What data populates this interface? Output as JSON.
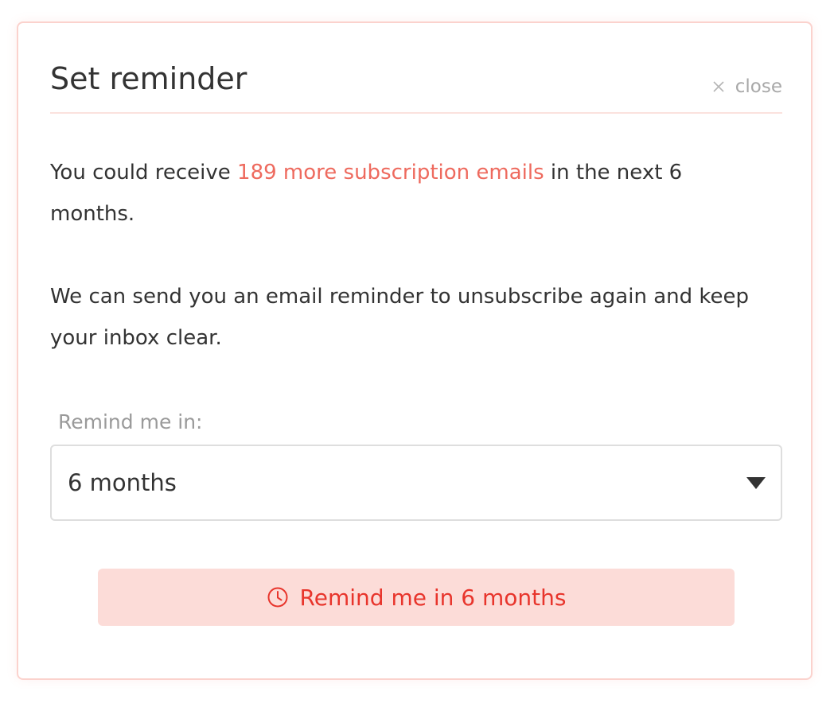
{
  "dialog": {
    "title": "Set reminder",
    "close_label": "close"
  },
  "intro": {
    "before": "You could receive ",
    "highlight": "189 more subscription emails",
    "after": " in the next 6 months."
  },
  "reminder_text": "We can send you an email reminder to unsubscribe again and keep your inbox clear.",
  "remind_field": {
    "label": "Remind me in:",
    "selected_value": "6 months"
  },
  "action_button": {
    "label": "Remind me in 6 months"
  },
  "icons": {
    "close": "close-icon",
    "select_arrow": "caret-down-icon",
    "button_icon": "clock-icon"
  },
  "colors": {
    "accent": "#ee6a5e",
    "button_text": "#e8352c",
    "button_bg": "#fcdcd8",
    "border": "#fbd2cd"
  }
}
